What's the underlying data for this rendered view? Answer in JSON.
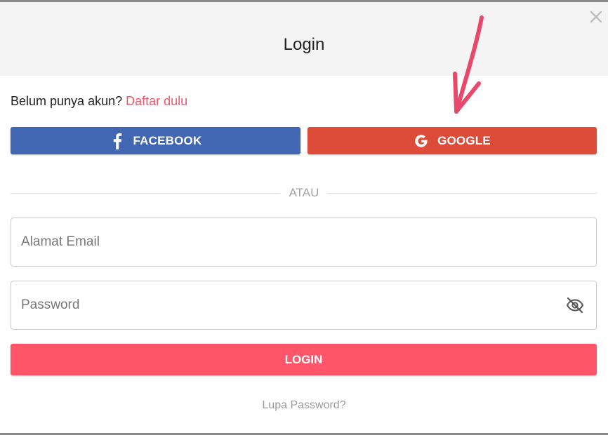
{
  "modal": {
    "title": "Login",
    "close_icon": "close-icon"
  },
  "signup": {
    "prompt": "Belum punya akun?",
    "link_label": "Daftar dulu"
  },
  "social": {
    "facebook_label": "FACEBOOK",
    "facebook_icon": "facebook-icon",
    "google_label": "GOOGLE",
    "google_icon": "google-icon"
  },
  "divider": {
    "label": "ATAU"
  },
  "form": {
    "email_placeholder": "Alamat Email",
    "email_value": "",
    "password_placeholder": "Password",
    "password_value": "",
    "password_toggle_icon": "eye-off-icon",
    "login_label": "LOGIN",
    "forgot_label": "Lupa Password?"
  },
  "annotation": {
    "arrow_icon": "arrow-down-icon"
  },
  "colors": {
    "facebook": "#4267b2",
    "google": "#dd4b39",
    "accent": "#ff5569",
    "link": "#f0566c",
    "arrow": "#e8486a"
  }
}
